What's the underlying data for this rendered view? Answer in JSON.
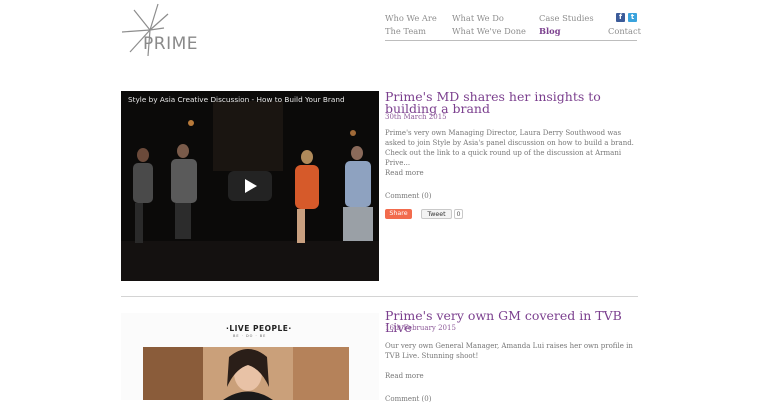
{
  "logo": {
    "text": "PRIME",
    "icon": "starburst-logo"
  },
  "nav": {
    "items": [
      {
        "label": "Who We Are",
        "active": false
      },
      {
        "label": "What We Do",
        "active": false
      },
      {
        "label": "Case Studies",
        "active": false
      },
      {
        "label": "The Team",
        "active": false
      },
      {
        "label": "What We've Done",
        "active": false
      },
      {
        "label": "Blog",
        "active": true
      },
      {
        "label": "Contact",
        "active": false
      }
    ],
    "social": [
      {
        "icon": "facebook-icon",
        "glyph": "f"
      },
      {
        "icon": "twitter-icon",
        "glyph": "t"
      }
    ]
  },
  "colors": {
    "accent": "#7b3f8e",
    "nav_text": "#8e8e8e",
    "share": "#f26b4d",
    "facebook": "#3b5b99",
    "twitter": "#3aa3dd"
  },
  "posts": [
    {
      "media_type": "video",
      "video_title": "Style by Asia Creative Discussion - How to Build Your Brand",
      "title": "Prime's MD shares her insights to building a brand",
      "date": "30th March 2015",
      "body": "Prime's very own Managing Director, Laura Derry Southwood was asked to join Style by Asia's panel discussion on how to build a brand. Check out the link to a quick round up of the discussion at Armani Prive...",
      "read_more": "Read more",
      "comment": "Comment  (0)",
      "share_label": "Share",
      "tweet_label": "Tweet",
      "tweet_count": "0"
    },
    {
      "media_type": "image",
      "image_logo": "·LIVE PEOPLE·",
      "image_logo_sub": "BE · DO · BE",
      "title": "Prime's very own GM covered in TVB Live",
      "date": "16th February 2015",
      "body": "Our very own General Manager, Amanda Lui raises her own profile in TVB Live. Stunning shoot!",
      "read_more": "Read more",
      "comment": "Comment  (0)"
    }
  ]
}
